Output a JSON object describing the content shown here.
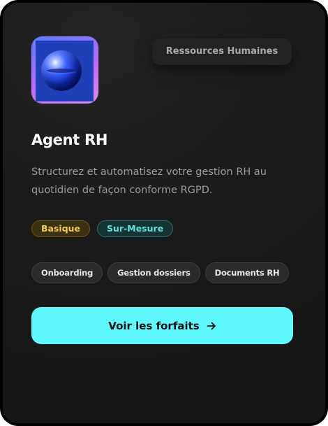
{
  "card": {
    "category": "Ressources Humaines",
    "title": "Agent RH",
    "description": "Structurez et automatisez votre gestion RH au quotidien de façon conforme RGPD.",
    "plans": [
      "Basique",
      "Sur-Mesure"
    ],
    "features": [
      "Onboarding",
      "Gestion dossiers",
      "Documents RH"
    ],
    "cta_label": "Voir les forfaits",
    "cta_icon": "arrow-right-icon",
    "app_icon": "blue-sphere-icon"
  },
  "colors": {
    "accent": "#5ff8ff",
    "basique": "#f2c94c",
    "sur_mesure": "#5fe0e0",
    "background": "#1b1b1b"
  }
}
